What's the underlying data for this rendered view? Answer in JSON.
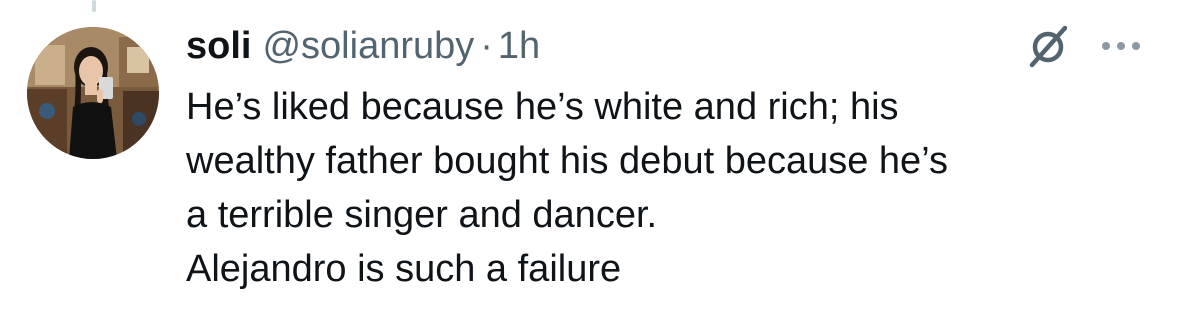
{
  "tweet": {
    "author": {
      "display_name": "soli",
      "handle": "@solianruby",
      "avatar": "avatar-photo"
    },
    "separator": "·",
    "timestamp": "1h",
    "text_lines": [
      "He’s liked because he’s white and rich; his",
      "wealthy father bought his debut because he’s",
      "a terrible singer and dancer.",
      "Alejandro is such a failure"
    ],
    "actions": {
      "grok_icon": "grok-icon",
      "more_icon": "more-horizontal-icon"
    }
  },
  "colors": {
    "text_primary": "#0f1419",
    "text_secondary": "#536471",
    "thread_line": "#cfd9de"
  }
}
